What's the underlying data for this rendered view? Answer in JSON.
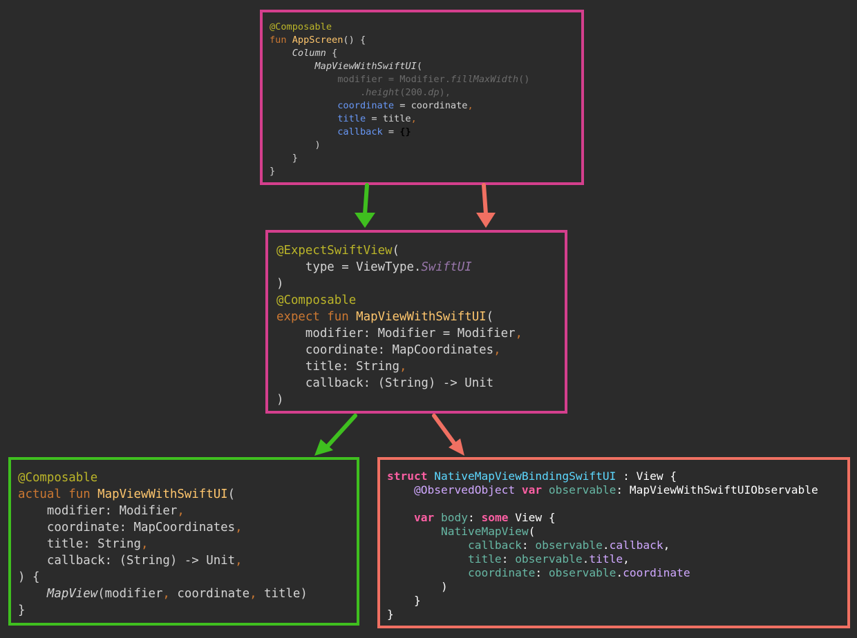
{
  "colors": {
    "box_top_border": "#d43f8d",
    "box_middle_border": "#d43f8d",
    "box_left_border": "#3fbf1f",
    "box_right_border": "#f07062",
    "arrow_green": "#3fbf1f",
    "arrow_salmon": "#f07062"
  },
  "app_screen": [
    [
      [
        "ann",
        "@Composable"
      ]
    ],
    [
      [
        "kw",
        "fun "
      ],
      [
        "fn",
        "AppScreen"
      ],
      [
        "def",
        "() {"
      ]
    ],
    [
      [
        "def",
        "    "
      ],
      [
        "it",
        "Column"
      ],
      [
        "def",
        " {"
      ]
    ],
    [
      [
        "def",
        "        "
      ],
      [
        "it",
        "MapViewWithSwiftUI"
      ],
      [
        "def",
        "("
      ]
    ],
    [
      [
        "def",
        "            "
      ],
      [
        "dim",
        "modifier = Modifier."
      ],
      [
        "dimit",
        "fillMaxWidth"
      ],
      [
        "dim",
        "()"
      ]
    ],
    [
      [
        "def",
        "                "
      ],
      [
        "dim",
        "."
      ],
      [
        "dimit",
        "height"
      ],
      [
        "dim",
        "(200."
      ],
      [
        "dimit",
        "dp"
      ],
      [
        "dim",
        "),"
      ]
    ],
    [
      [
        "def",
        "            "
      ],
      [
        "blue",
        "coordinate"
      ],
      [
        "def",
        " = coordinate"
      ],
      [
        "orange",
        ","
      ]
    ],
    [
      [
        "def",
        "            "
      ],
      [
        "blue",
        "title"
      ],
      [
        "def",
        " = title"
      ],
      [
        "orange",
        ","
      ]
    ],
    [
      [
        "def",
        "            "
      ],
      [
        "blue",
        "callback"
      ],
      [
        "def",
        " = "
      ],
      [
        "bold",
        "{}"
      ]
    ],
    [
      [
        "def",
        "        )"
      ]
    ],
    [
      [
        "def",
        "    }"
      ]
    ],
    [
      [
        "def",
        "}"
      ]
    ]
  ],
  "expect_view": [
    [
      [
        "ann",
        "@ExpectSwiftView"
      ],
      [
        "def",
        "("
      ]
    ],
    [
      [
        "def",
        "    type = ViewType."
      ],
      [
        "purple",
        "SwiftUI"
      ]
    ],
    [
      [
        "def",
        ")"
      ]
    ],
    [
      [
        "ann",
        "@Composable"
      ]
    ],
    [
      [
        "kw",
        "expect fun "
      ],
      [
        "fn",
        "MapViewWithSwiftUI"
      ],
      [
        "def",
        "("
      ]
    ],
    [
      [
        "def",
        "    modifier: Modifier = Modifier"
      ],
      [
        "orange",
        ","
      ]
    ],
    [
      [
        "def",
        "    coordinate: MapCoordinates"
      ],
      [
        "orange",
        ","
      ]
    ],
    [
      [
        "def",
        "    title: String"
      ],
      [
        "orange",
        ","
      ]
    ],
    [
      [
        "def",
        "    callback: (String) -> Unit"
      ]
    ],
    [
      [
        "def",
        ")"
      ]
    ]
  ],
  "actual_view": [
    [
      [
        "ann",
        "@Composable"
      ]
    ],
    [
      [
        "kw",
        "actual fun "
      ],
      [
        "fn",
        "MapViewWithSwiftUI"
      ],
      [
        "def",
        "("
      ]
    ],
    [
      [
        "def",
        "    modifier: Modifier"
      ],
      [
        "orange",
        ","
      ]
    ],
    [
      [
        "def",
        "    coordinate: MapCoordinates"
      ],
      [
        "orange",
        ","
      ]
    ],
    [
      [
        "def",
        "    title: String"
      ],
      [
        "orange",
        ","
      ]
    ],
    [
      [
        "def",
        "    callback: (String) -> Unit"
      ],
      [
        "orange",
        ","
      ]
    ],
    [
      [
        "def",
        ") {"
      ]
    ],
    [
      [
        "def",
        "    "
      ],
      [
        "it",
        "MapView"
      ],
      [
        "def",
        "(modifier"
      ],
      [
        "orange",
        ", "
      ],
      [
        "def",
        "coordinate"
      ],
      [
        "orange",
        ", "
      ],
      [
        "def",
        "title)"
      ]
    ],
    [
      [
        "def",
        "}"
      ]
    ]
  ],
  "swift_view": [
    [
      [
        "pink",
        "struct "
      ],
      [
        "cyan",
        "NativeMapViewBindingSwiftUI"
      ],
      [
        "white",
        " : View {"
      ]
    ],
    [
      [
        "white",
        "    "
      ],
      [
        "sv",
        "@ObservedObject "
      ],
      [
        "pink",
        "var "
      ],
      [
        "teal",
        "observable"
      ],
      [
        "white",
        ": MapViewWithSwiftUIObservable"
      ]
    ],
    [
      [
        "white",
        " "
      ]
    ],
    [
      [
        "white",
        "    "
      ],
      [
        "pink",
        "var "
      ],
      [
        "teal",
        "body"
      ],
      [
        "white",
        ": "
      ],
      [
        "pink",
        "some "
      ],
      [
        "white",
        "View {"
      ]
    ],
    [
      [
        "white",
        "        "
      ],
      [
        "teal",
        "NativeMapView"
      ],
      [
        "white",
        "("
      ]
    ],
    [
      [
        "white",
        "            "
      ],
      [
        "teal",
        "callback"
      ],
      [
        "white",
        ": "
      ],
      [
        "teal",
        "observable"
      ],
      [
        "white",
        "."
      ],
      [
        "sv",
        "callback"
      ],
      [
        "white",
        ","
      ]
    ],
    [
      [
        "white",
        "            "
      ],
      [
        "teal",
        "title"
      ],
      [
        "white",
        ": "
      ],
      [
        "teal",
        "observable"
      ],
      [
        "white",
        "."
      ],
      [
        "sv",
        "title"
      ],
      [
        "white",
        ","
      ]
    ],
    [
      [
        "white",
        "            "
      ],
      [
        "teal",
        "coordinate"
      ],
      [
        "white",
        ": "
      ],
      [
        "teal",
        "observable"
      ],
      [
        "white",
        "."
      ],
      [
        "sv",
        "coordinate"
      ]
    ],
    [
      [
        "white",
        "        )"
      ]
    ],
    [
      [
        "white",
        "    }"
      ]
    ],
    [
      [
        "white",
        "}"
      ]
    ]
  ]
}
